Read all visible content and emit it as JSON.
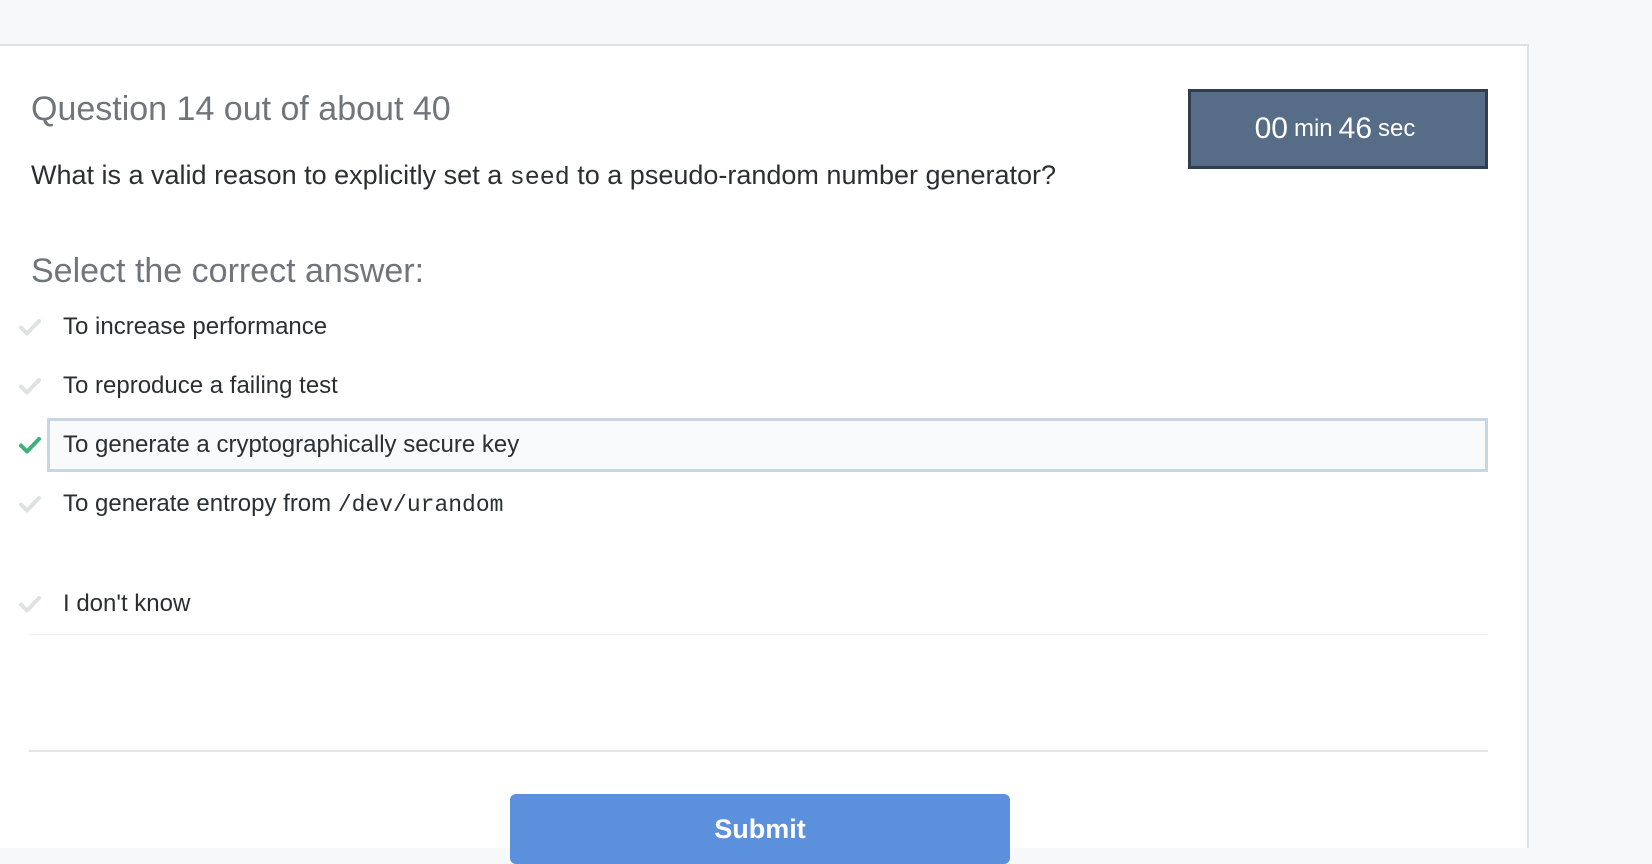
{
  "quiz": {
    "question_counter": "Question 14 out of about 40",
    "timer": {
      "minutes": "00",
      "min_unit": "min",
      "seconds": "46",
      "sec_unit": "sec"
    },
    "question": {
      "text_before": "What is a valid reason to explicitly set a",
      "code": "seed",
      "text_after": "to a pseudo-random number generator?"
    },
    "select_label": "Select the correct answer:",
    "answers": [
      {
        "label": "To increase performance",
        "code": "",
        "selected": false
      },
      {
        "label": "To reproduce a failing test",
        "code": "",
        "selected": false
      },
      {
        "label": "To generate a cryptographically secure key",
        "code": "",
        "selected": true
      },
      {
        "label": "To generate entropy from",
        "code": "/dev/urandom",
        "selected": false
      }
    ],
    "dont_know_label": "I don't know",
    "submit_label": "Submit"
  },
  "colors": {
    "check_inactive": "#dfe1e3",
    "check_selected": "#3fb077",
    "submit_bg": "#5b90dc",
    "timer_bg": "#566c87"
  },
  "icons": {
    "answer_check": "check-icon"
  }
}
